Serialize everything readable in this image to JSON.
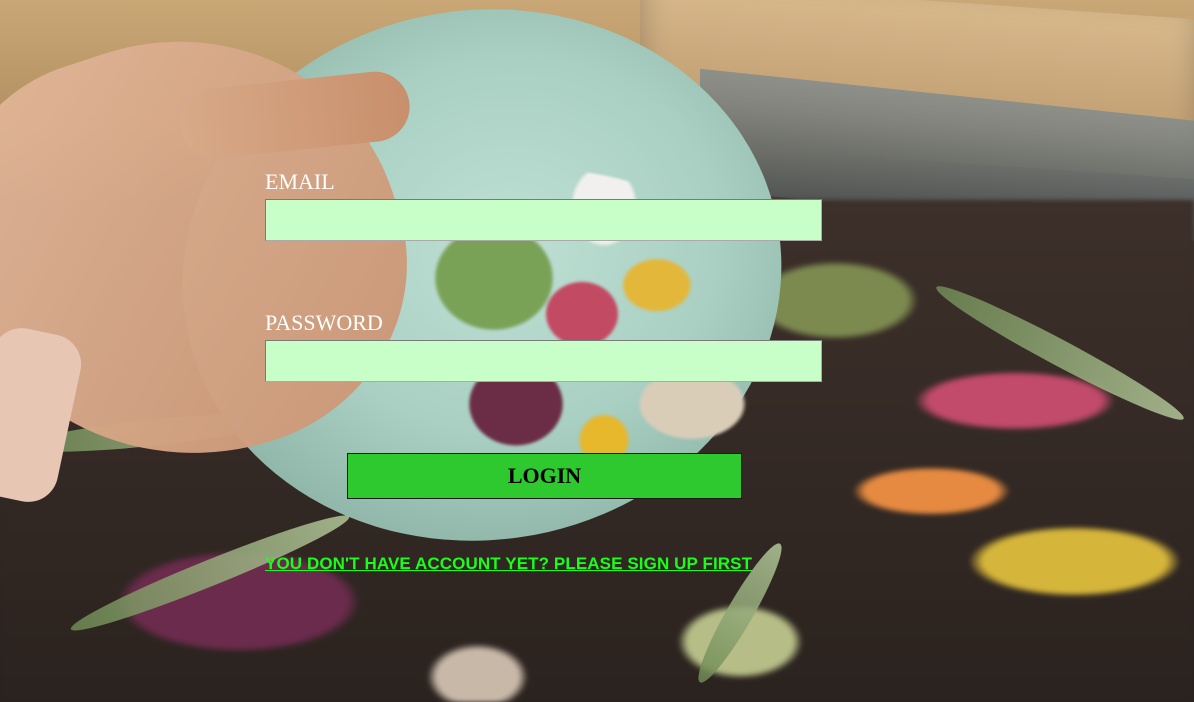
{
  "login_form": {
    "email_label": "EMAIL",
    "email_value": "",
    "password_label": "PASSWORD",
    "password_value": "",
    "login_button_label": "LOGIN",
    "signup_link_text": "YOU DON'T HAVE ACCOUNT YET? PLEASE SIGN UP FIRST"
  },
  "colors": {
    "input_background": "#c8fec8",
    "button_background": "#2ec92e",
    "link_color": "#19ff19",
    "label_color": "#ffffff"
  },
  "background": {
    "image": "compost-food-scraps-photo"
  }
}
